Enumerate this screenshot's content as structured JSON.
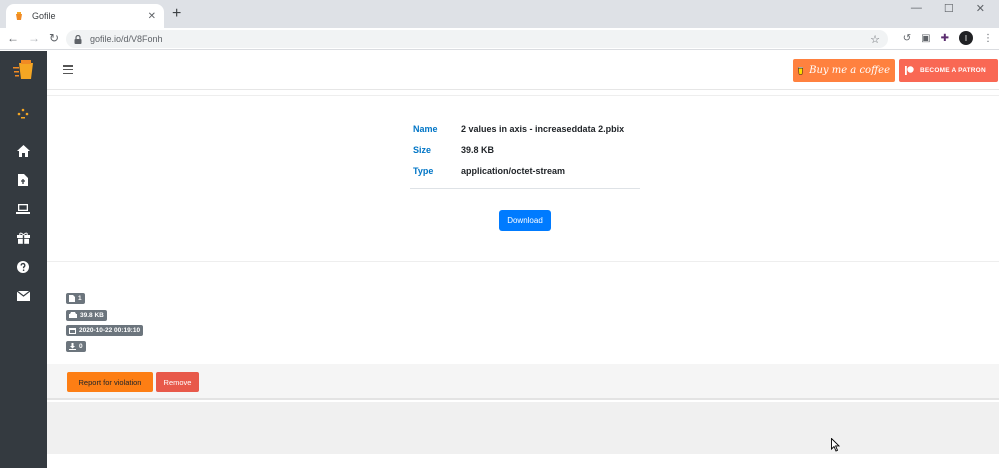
{
  "browser": {
    "tab_title": "Gofile",
    "tab_close": "✕",
    "new_tab": "+",
    "url": "gofile.io/d/V8Fonh",
    "win_min": "—",
    "win_max": "☐",
    "win_close": "✕",
    "profile_initial": "I"
  },
  "navbar": {
    "coffee_label": "Buy me a coffee",
    "patron_label": "BECOME A PATRON"
  },
  "file": {
    "name_key": "Name",
    "name_val": "2 values in axis - increaseddata 2.pbix",
    "size_key": "Size",
    "size_val": "39.8 KB",
    "type_key": "Type",
    "type_val": "application/octet-stream",
    "download_label": "Download"
  },
  "stats": {
    "files": "1",
    "size": "39.8 KB",
    "date": "2020-10-22 00:19:10",
    "downloads": "0"
  },
  "actions": {
    "report_label": "Report for violation",
    "remove_label": "Remove"
  },
  "colors": {
    "sidebar_bg": "#343a40",
    "accent_blue": "#007bff",
    "coffee_orange": "#ff813f",
    "patron_red": "#f96854",
    "report_orange": "#fd7e14",
    "remove_red": "#e8594a"
  }
}
